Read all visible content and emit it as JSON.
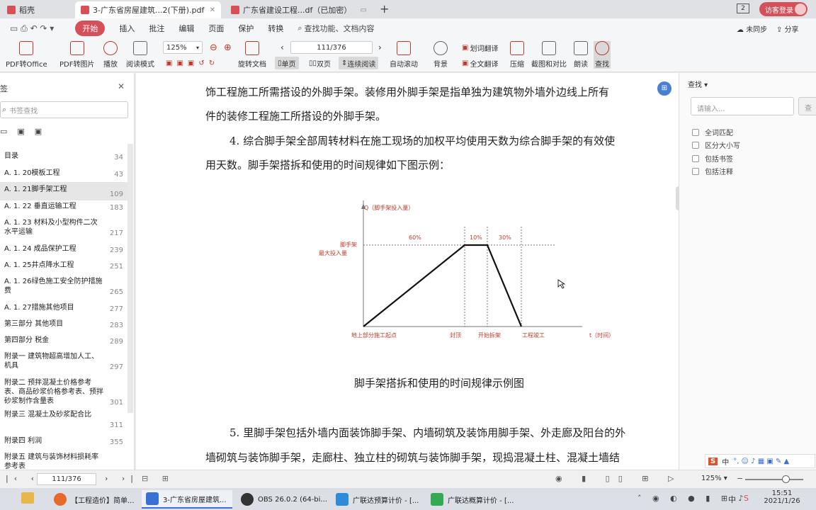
{
  "tabs": [
    {
      "label": "稻壳",
      "icon_color": "#d6505a"
    },
    {
      "label": "3-广东省房屋建筑...2(下册).pdf",
      "icon_color": "#d6505a",
      "active": true
    },
    {
      "label": "广东省建设工程...df（已加密）",
      "icon_color": "#d6505a"
    }
  ],
  "window": {
    "count_badge": "2",
    "login_label": "访客登录",
    "accent": "#d6505a"
  },
  "menu": {
    "items": [
      "开始",
      "插入",
      "批注",
      "编辑",
      "页面",
      "保护",
      "转换"
    ],
    "search_label": "查找功能、文档内容",
    "sync_label": "未同步",
    "share_label": "分享"
  },
  "toolbar": {
    "pdf_to_office": "PDF转Office",
    "pdf_to_image": "PDF转图片",
    "play": "播放",
    "read_mode": "阅读模式",
    "zoom": "125%",
    "rotate": "旋转文档",
    "page_input": "111/376",
    "single": "单页",
    "double": "双页",
    "continuous": "连续阅读",
    "autoscroll": "自动滚动",
    "background": "背景",
    "translate_word": "划词翻译",
    "translate_all": "全文翻译",
    "compress": "压缩",
    "screenshot": "截图和对比",
    "read_aloud": "朗读",
    "find": "查找"
  },
  "sidebar": {
    "title": "签",
    "search_placeholder": "书签查找",
    "items": [
      {
        "label": "目录",
        "page": "34"
      },
      {
        "label": "A. 1. 20模板工程",
        "page": "43"
      },
      {
        "label": "A. 1. 21脚手架工程",
        "page": "109",
        "selected": true
      },
      {
        "label": "A. 1. 22 垂直运输工程",
        "page": "183"
      },
      {
        "label": "A. 1. 23 材料及小型构件二次水平运输",
        "page": "217"
      },
      {
        "label": "A. 1. 24 成品保护工程",
        "page": "239"
      },
      {
        "label": "A. 1. 25井点降水工程",
        "page": "251"
      },
      {
        "label": "A. 1. 26绿色施工安全防护措施费",
        "page": "265"
      },
      {
        "label": "A. 1. 27措施其他项目",
        "page": "277"
      },
      {
        "label": "第三部分 其他项目",
        "page": "283"
      },
      {
        "label": "第四部分 税金",
        "page": "289"
      },
      {
        "label": "附录一 建筑物超高增加人工、机具",
        "page": "297"
      },
      {
        "label": "附录二 预拌混凝土价格参考表、商品砂浆价格参考表、预拌砂浆制作含量表",
        "page": "301"
      },
      {
        "label": "附录三 混凝土及砂浆配合比",
        "page": "311"
      },
      {
        "label": "附录四 利润",
        "page": "355"
      },
      {
        "label": "附录五 建筑与装饰材料损耗率参考表",
        "page": ""
      }
    ]
  },
  "document": {
    "para1_line1": "饰工程施工所需搭设的外脚手架。装修用外脚手架是指单独为建筑物外墙外边线上所有",
    "para1_line2": "件的装修工程施工所搭设的外脚手架。",
    "para2_line1": "4. 综合脚手架全部周转材料在施工现场的加权平均使用天数为综合脚手架的有效使",
    "para2_line2": "用天数。脚手架搭拆和使用的时间规律如下图示例：",
    "caption": "脚手架搭拆和使用的时间规律示例图",
    "para3_line1": "5. 里脚手架包括外墙内面装饰脚手架、内墙砌筑及装饰用脚手架、外走廊及阳台的外",
    "para3_line2": "墙砌筑与装饰脚手架，走廊柱、独立柱的砌筑与装饰脚手架，现捣混凝土柱、混凝土墙结"
  },
  "diagram": {
    "y_axis_label": "Q（脚手架投入量）",
    "max_label_line1": "脚手架",
    "max_label_line2": "最大投入量",
    "seg_labels": [
      "60%",
      "10%",
      "30%"
    ],
    "x_labels": [
      "地上部分施工起点",
      "封顶",
      "开始拆架",
      "工程竣工"
    ],
    "x_axis_label": "t（时间）",
    "red_color": "#c0392b"
  },
  "right_panel": {
    "title": "查找",
    "placeholder": "请输入...",
    "search_button": "查",
    "options": [
      "全词匹配",
      "区分大小写",
      "包括书签",
      "包括注释"
    ]
  },
  "status": {
    "page_input": "111/376",
    "zoom": "125%"
  },
  "taskbar": {
    "items": [
      "【工程造价】简单...",
      "3-广东省房屋建筑...",
      "OBS 26.0.2 (64-bi...",
      "广联达预算计价 - [...",
      "广联达概算计价 - [..."
    ],
    "ime": "中",
    "time": "15:51",
    "date": "2021/1/26"
  }
}
